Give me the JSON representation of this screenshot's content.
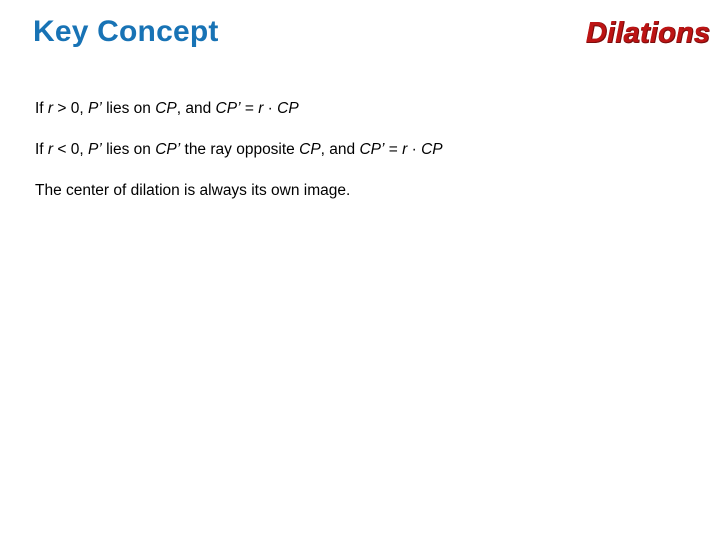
{
  "slide": {
    "background_color": "#ffffff",
    "header": {
      "title_left": "Key Concept",
      "title_left_color": "#1873b5",
      "title_right": "Dilations",
      "title_right_color": "#bd1414"
    },
    "body": {
      "lines": [
        {
          "id": "positive-scale-factor-rule",
          "segments": [
            {
              "text": "If ",
              "italic": false
            },
            {
              "text": "r",
              "italic": true
            },
            {
              "text": " > 0, ",
              "italic": false
            },
            {
              "text": "P’",
              "italic": true
            },
            {
              "text": " lies on ",
              "italic": false
            },
            {
              "text": "CP",
              "italic": true
            },
            {
              "text": ", and ",
              "italic": false
            },
            {
              "text": "CP’",
              "italic": true
            },
            {
              "text": " = ",
              "italic": false
            },
            {
              "text": "r",
              "italic": true
            },
            {
              "text": " · ",
              "italic": false
            },
            {
              "text": "CP",
              "italic": true
            }
          ],
          "plain_text": "If r > 0, P’ lies on CP, and CP’ = r · CP"
        },
        {
          "id": "negative-scale-factor-rule",
          "segments": [
            {
              "text": "If ",
              "italic": false
            },
            {
              "text": "r",
              "italic": true
            },
            {
              "text": " < 0, ",
              "italic": false
            },
            {
              "text": "P’",
              "italic": true
            },
            {
              "text": " lies on ",
              "italic": false
            },
            {
              "text": "CP’",
              "italic": true
            },
            {
              "text": " the ray opposite ",
              "italic": false
            },
            {
              "text": "CP",
              "italic": true
            },
            {
              "text": ", and ",
              "italic": false
            },
            {
              "text": "CP’",
              "italic": true
            },
            {
              "text": " = ",
              "italic": false
            },
            {
              "text": "r",
              "italic": true
            },
            {
              "text": " · ",
              "italic": false
            },
            {
              "text": "CP",
              "italic": true
            }
          ],
          "plain_text": "If r < 0, P’ lies on CP’ the ray opposite CP, and CP’ = r · CP"
        },
        {
          "id": "center-of-dilation-rule",
          "segments": [
            {
              "text": "The center of dilation is always its own image.",
              "italic": false
            }
          ],
          "plain_text": "The center of dilation is always its own image."
        }
      ]
    }
  }
}
